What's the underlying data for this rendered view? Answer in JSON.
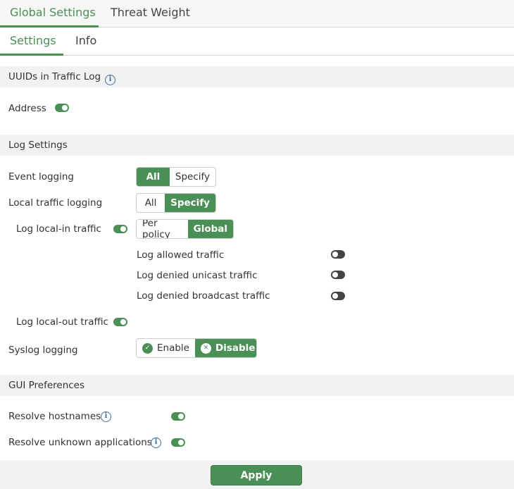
{
  "tabs": [
    "Global Settings",
    "Threat Weight"
  ],
  "subtabs": [
    "Settings",
    "Info"
  ],
  "sections": {
    "uuids": "UUIDs in Traffic Log",
    "log": "Log Settings",
    "gui": "GUI Preferences"
  },
  "uuids": {
    "address": "Address",
    "address_on": true
  },
  "log": {
    "event_logging": {
      "label": "Event logging",
      "options": [
        "All",
        "Specify"
      ],
      "selected": "All"
    },
    "local_traffic": {
      "label": "Local traffic logging",
      "options": [
        "All",
        "Specify"
      ],
      "selected": "Specify"
    },
    "local_in": {
      "label": "Log local-in traffic",
      "on": true,
      "options": [
        "Per policy",
        "Global"
      ],
      "selected": "Global"
    },
    "sub": [
      {
        "label": "Log allowed traffic",
        "on": false
      },
      {
        "label": "Log denied unicast traffic",
        "on": false
      },
      {
        "label": "Log denied broadcast traffic",
        "on": false
      }
    ],
    "local_out": {
      "label": "Log local-out traffic",
      "on": true
    },
    "syslog": {
      "label": "Syslog logging",
      "options": [
        "Enable",
        "Disable"
      ],
      "selected": "Disable"
    }
  },
  "gui": {
    "resolve_hostnames": "Resolve hostnames",
    "resolve_apps": "Resolve unknown applications"
  },
  "apply": "Apply",
  "colors": {
    "accent": "#4a8f55"
  }
}
